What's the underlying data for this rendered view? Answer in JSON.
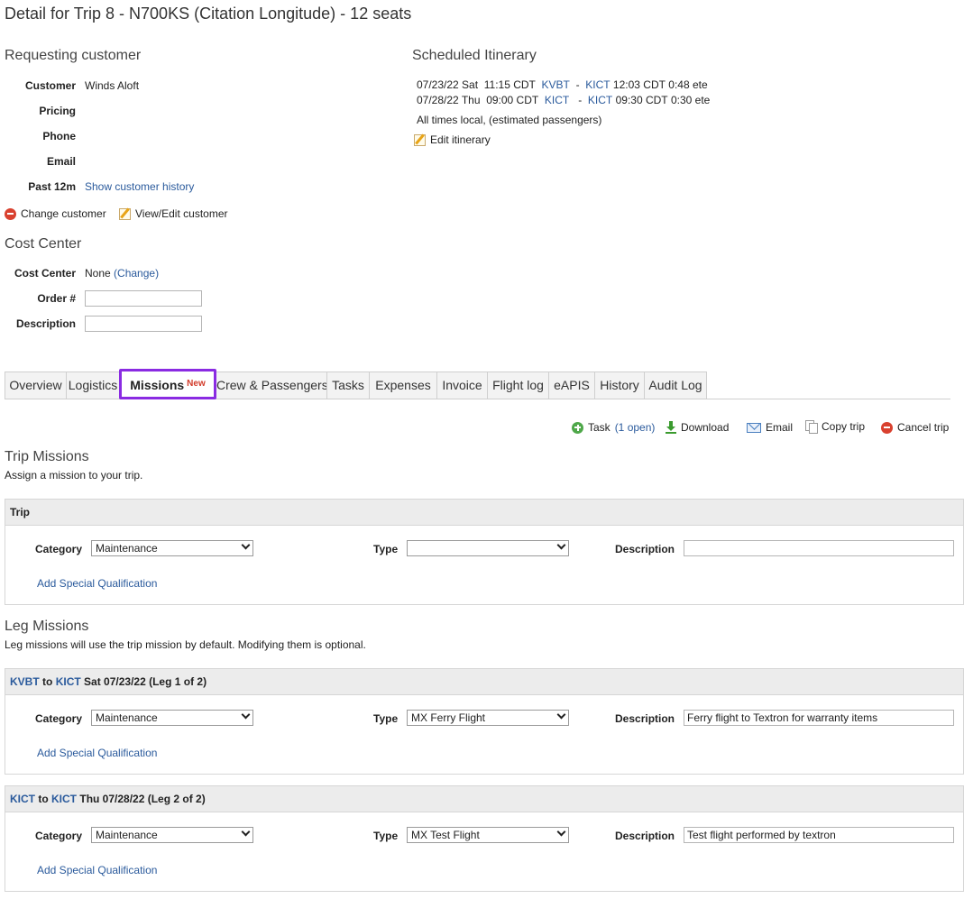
{
  "page_title": "Detail for Trip 8 - N700KS (Citation Longitude) - 12 seats",
  "customer_section": {
    "title": "Requesting customer",
    "rows": [
      {
        "label": "Customer",
        "value": "Winds Aloft"
      },
      {
        "label": "Pricing",
        "value": ""
      },
      {
        "label": "Phone",
        "value": ""
      },
      {
        "label": "Email",
        "value": ""
      },
      {
        "label": "Past 12m",
        "value": "Show customer history"
      }
    ],
    "change_customer": "Change customer",
    "view_edit_customer": "View/Edit customer"
  },
  "itinerary": {
    "title": "Scheduled Itinerary",
    "legs": [
      {
        "date": "07/23/22 Sat",
        "dep_time": "11:15 CDT",
        "from": "KVBT",
        "sep": "-",
        "to": "KICT",
        "arr_time": "12:03 CDT",
        "ete": "0:48 ete"
      },
      {
        "date": "07/28/22 Thu",
        "dep_time": "09:00 CDT",
        "from": "KICT",
        "sep": "-",
        "to": "KICT",
        "arr_time": "09:30 CDT",
        "ete": "0:30 ete"
      }
    ],
    "note": "All times local, (estimated passengers)",
    "edit_label": "Edit itinerary"
  },
  "cost_center": {
    "title": "Cost Center",
    "cost_center_label": "Cost Center",
    "cost_center_value": "None",
    "change_label": "(Change)",
    "order_label": "Order #",
    "order_value": "",
    "description_label": "Description",
    "description_value": ""
  },
  "tabs": [
    {
      "label": "Overview"
    },
    {
      "label": "Logistics"
    },
    {
      "label": "Missions",
      "badge": "New",
      "active": true
    },
    {
      "label": "Crew & Passengers"
    },
    {
      "label": "Tasks"
    },
    {
      "label": "Expenses"
    },
    {
      "label": "Invoice"
    },
    {
      "label": "Flight log"
    },
    {
      "label": "eAPIS"
    },
    {
      "label": "History"
    },
    {
      "label": "Audit Log"
    }
  ],
  "actions": {
    "task_label": "Task",
    "task_count": "(1 open)",
    "download": "Download",
    "email": "Email",
    "copy_trip": "Copy trip",
    "cancel_trip": "Cancel trip"
  },
  "trip_missions": {
    "title": "Trip Missions",
    "subtitle": "Assign a mission to your trip.",
    "panel_title": "Trip",
    "category_label": "Category",
    "category_value": "Maintenance",
    "type_label": "Type",
    "type_value": "",
    "description_label": "Description",
    "description_value": "",
    "add_qual": "Add Special Qualification"
  },
  "leg_missions": {
    "title": "Leg Missions",
    "subtitle": "Leg missions will use the trip mission by default. Modifying them is optional.",
    "legs": [
      {
        "from": "KVBT",
        "to_word": "to",
        "to": "KICT",
        "info": "Sat 07/23/22 (Leg 1 of 2)",
        "category_label": "Category",
        "category_value": "Maintenance",
        "type_label": "Type",
        "type_value": "MX Ferry Flight",
        "description_label": "Description",
        "description_value": "Ferry flight to Textron for warranty items",
        "add_qual": "Add Special Qualification"
      },
      {
        "from": "KICT",
        "to_word": "to",
        "to": "KICT",
        "info": "Thu 07/28/22 (Leg 2 of 2)",
        "category_label": "Category",
        "category_value": "Maintenance",
        "type_label": "Type",
        "type_value": "MX Test Flight",
        "description_label": "Description",
        "description_value": "Test flight performed by textron",
        "add_qual": "Add Special Qualification"
      }
    ]
  },
  "colors": {
    "link": "#2a5a9c",
    "active_tab_border": "#8a2be2",
    "new_badge": "#d23b2a"
  }
}
